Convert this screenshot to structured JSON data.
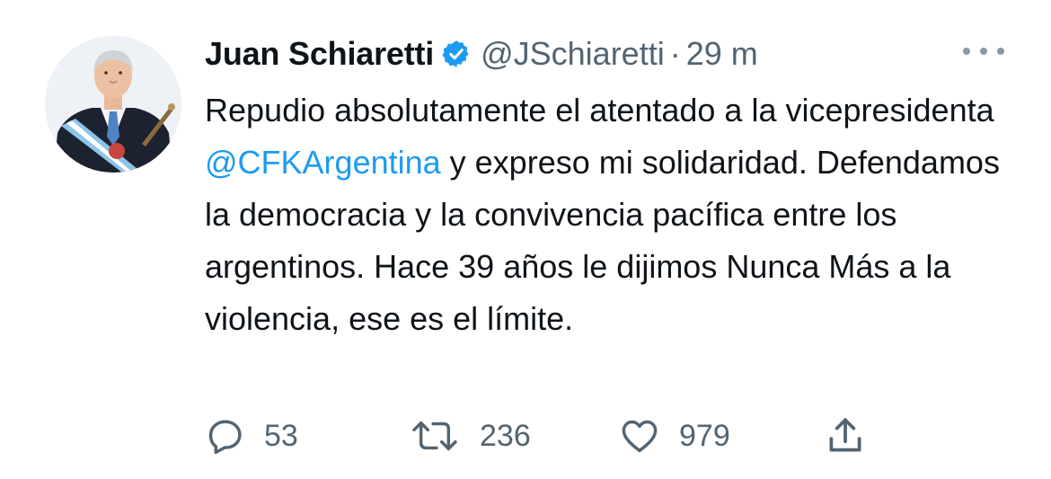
{
  "tweet": {
    "display_name": "Juan Schiaretti",
    "handle": "@JSchiaretti",
    "separator": "·",
    "timestamp": "29 m",
    "text_before": "Repudio absolutamente el atentado a la vicepresidenta ",
    "mention": "@CFKArgentina",
    "text_after": " y expreso mi solidaridad. Defendamos la democracia y la convivencia pacífica entre los argentinos. Hace 39 años le dijimos Nunca Más a la violencia, ese es el límite.",
    "verified": true
  },
  "actions": {
    "replies": "53",
    "retweets": "236",
    "likes": "979"
  },
  "icons": {
    "reply": "reply-icon",
    "retweet": "retweet-icon",
    "like": "like-icon",
    "share": "share-icon",
    "verified": "verified-badge-icon",
    "more": "more-icon"
  },
  "colors": {
    "accent": "#1d9bf0",
    "text": "#0f1419",
    "muted": "#536471"
  }
}
